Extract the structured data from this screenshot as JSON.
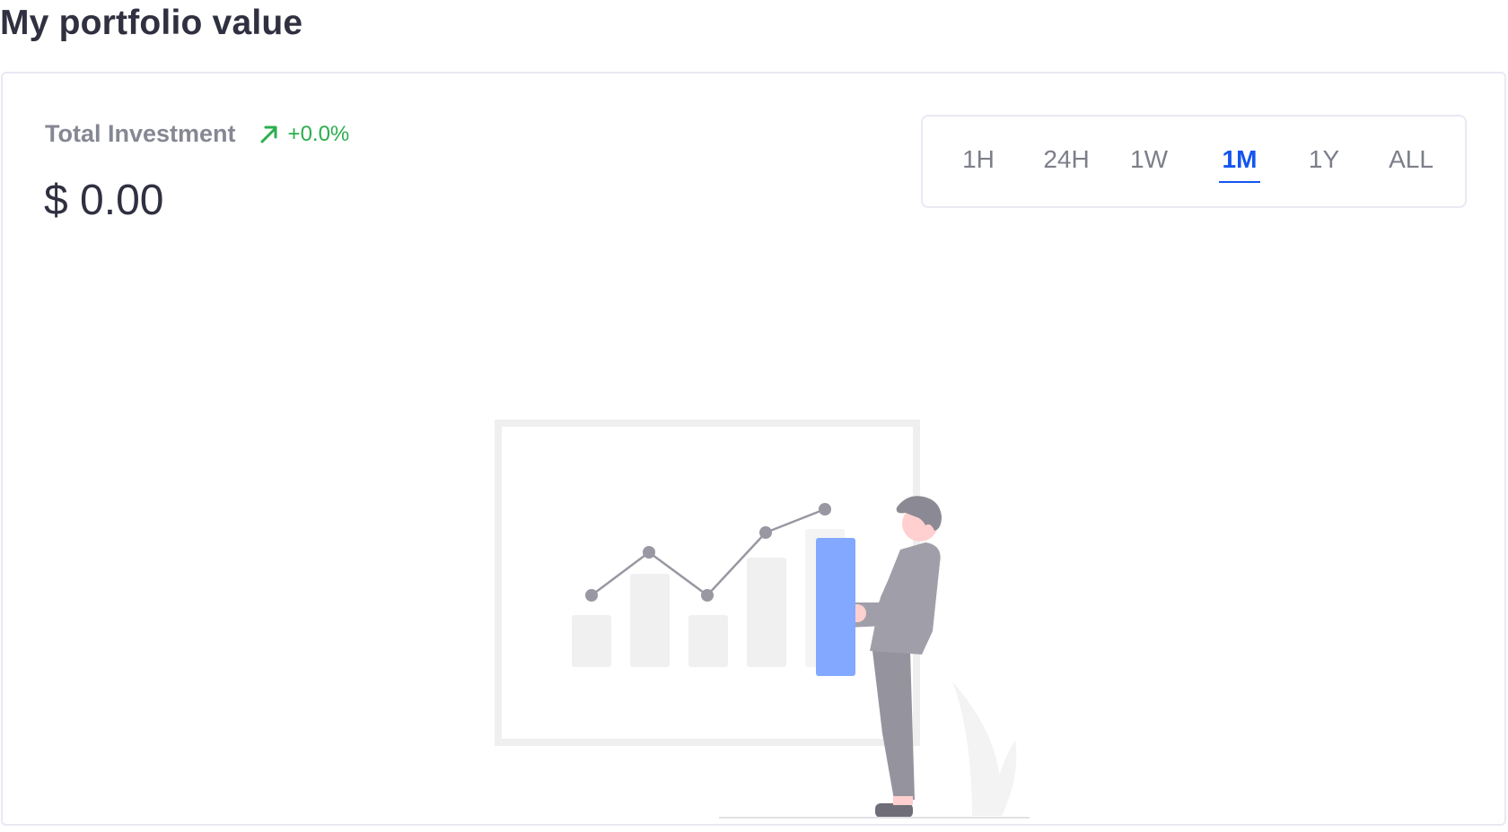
{
  "page": {
    "title": "My portfolio value"
  },
  "portfolio": {
    "label": "Total Investment",
    "change": "+0.0%",
    "change_icon": "arrow-up-right-icon",
    "value": "$ 0.00"
  },
  "range_tabs": {
    "items": [
      "1H",
      "24H",
      "1W",
      "1M",
      "1Y",
      "ALL"
    ],
    "selected": "1M"
  },
  "illustration": {
    "name": "empty-chart-illustration"
  },
  "colors": {
    "accent": "#1455f0",
    "positive": "#2bae4e",
    "muted_text": "#858793",
    "highlight_bar": "#83a8ff"
  }
}
